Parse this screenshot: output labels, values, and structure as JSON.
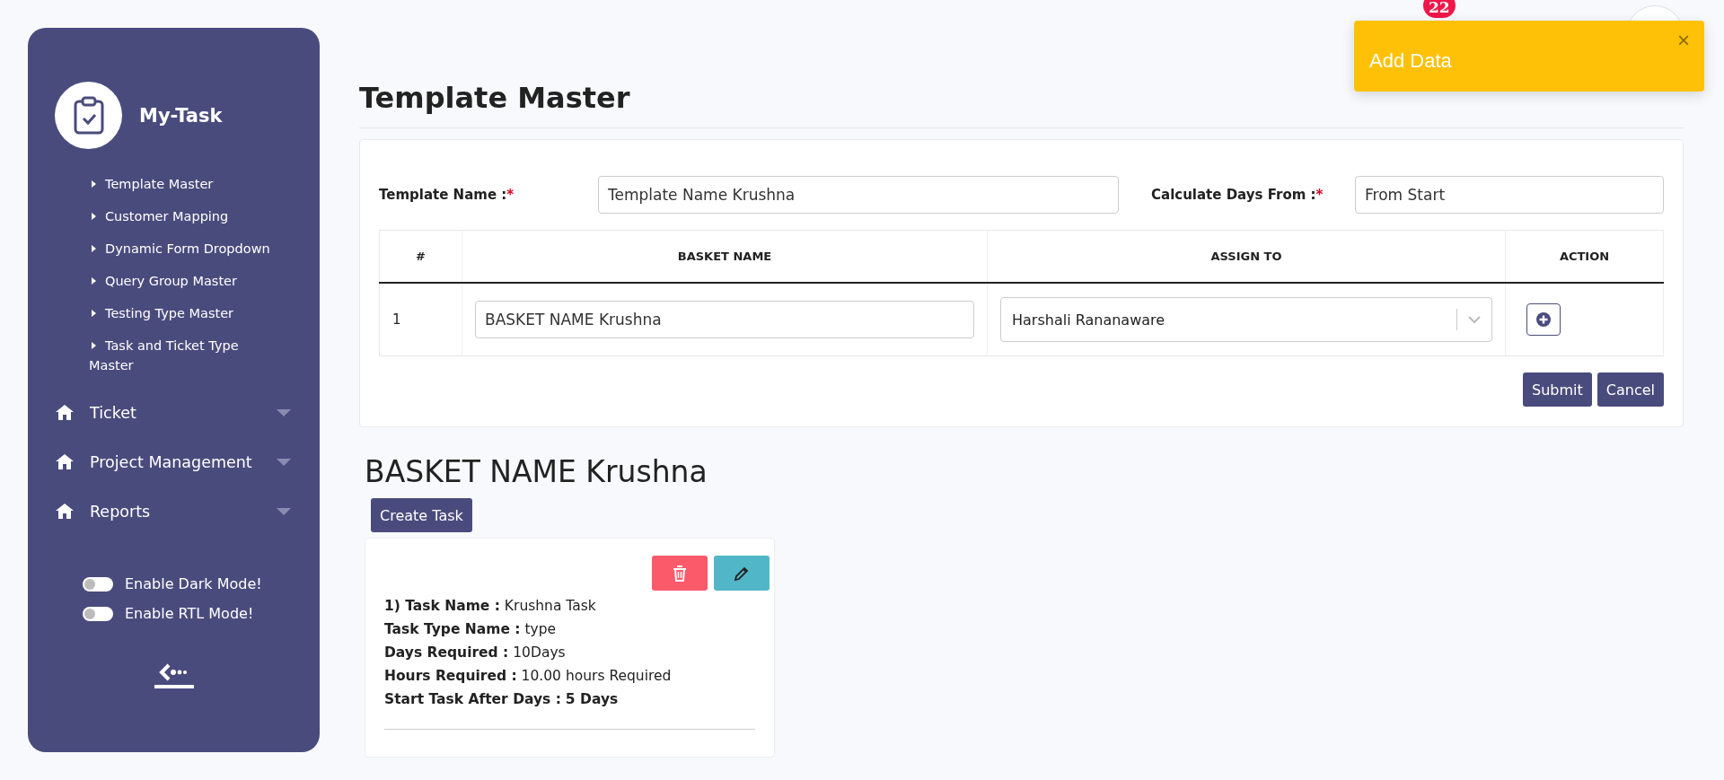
{
  "sidebar": {
    "brand": "My-Task",
    "submenu": [
      {
        "label": "Template Master"
      },
      {
        "label": "Customer Mapping"
      },
      {
        "label": "Dynamic Form Dropdown"
      },
      {
        "label": "Query Group Master"
      },
      {
        "label": "Testing Type Master"
      },
      {
        "label": "Task and Ticket Type Master"
      }
    ],
    "sections": [
      {
        "label": "Ticket"
      },
      {
        "label": "Project Management"
      },
      {
        "label": "Reports"
      }
    ],
    "toggles": [
      {
        "label": "Enable Dark Mode!",
        "checked": false
      },
      {
        "label": "Enable RTL Mode!",
        "checked": false
      }
    ]
  },
  "header": {
    "notification_count": "22"
  },
  "toast": {
    "message": "Add Data",
    "close": "×"
  },
  "page_title": "Template Master",
  "form": {
    "fields": [
      {
        "label": "Template Name :",
        "required_mark": "*",
        "value": "Template Name Krushna"
      },
      {
        "label": "Calculate Days From :",
        "required_mark": "*",
        "value": "From Start"
      }
    ],
    "table": {
      "columns": [
        "#",
        "BASKET NAME",
        "ASSIGN TO",
        "ACTION"
      ],
      "rows": [
        {
          "index": "1",
          "basket_name": "BASKET NAME Krushna",
          "assign_to": "Harshali Rananaware"
        }
      ]
    },
    "buttons": [
      "Submit",
      "Cancel"
    ]
  },
  "basket": {
    "title": "BASKET NAME Krushna",
    "create_button": "Create Task",
    "tasks": [
      {
        "details": [
          {
            "label": "1) Task Name :",
            "value": "Krushna Task",
            "value_bold": false
          },
          {
            "label": "Task Type Name :",
            "value": "type",
            "value_bold": false
          },
          {
            "label": "Days Required :",
            "value": "10Days",
            "value_bold": false
          },
          {
            "label": "Hours Required :",
            "value": "10.00 hours Required",
            "value_bold": false
          },
          {
            "label": "Start Task After Days :",
            "value": "5 Days",
            "value_bold": true
          }
        ]
      }
    ]
  }
}
